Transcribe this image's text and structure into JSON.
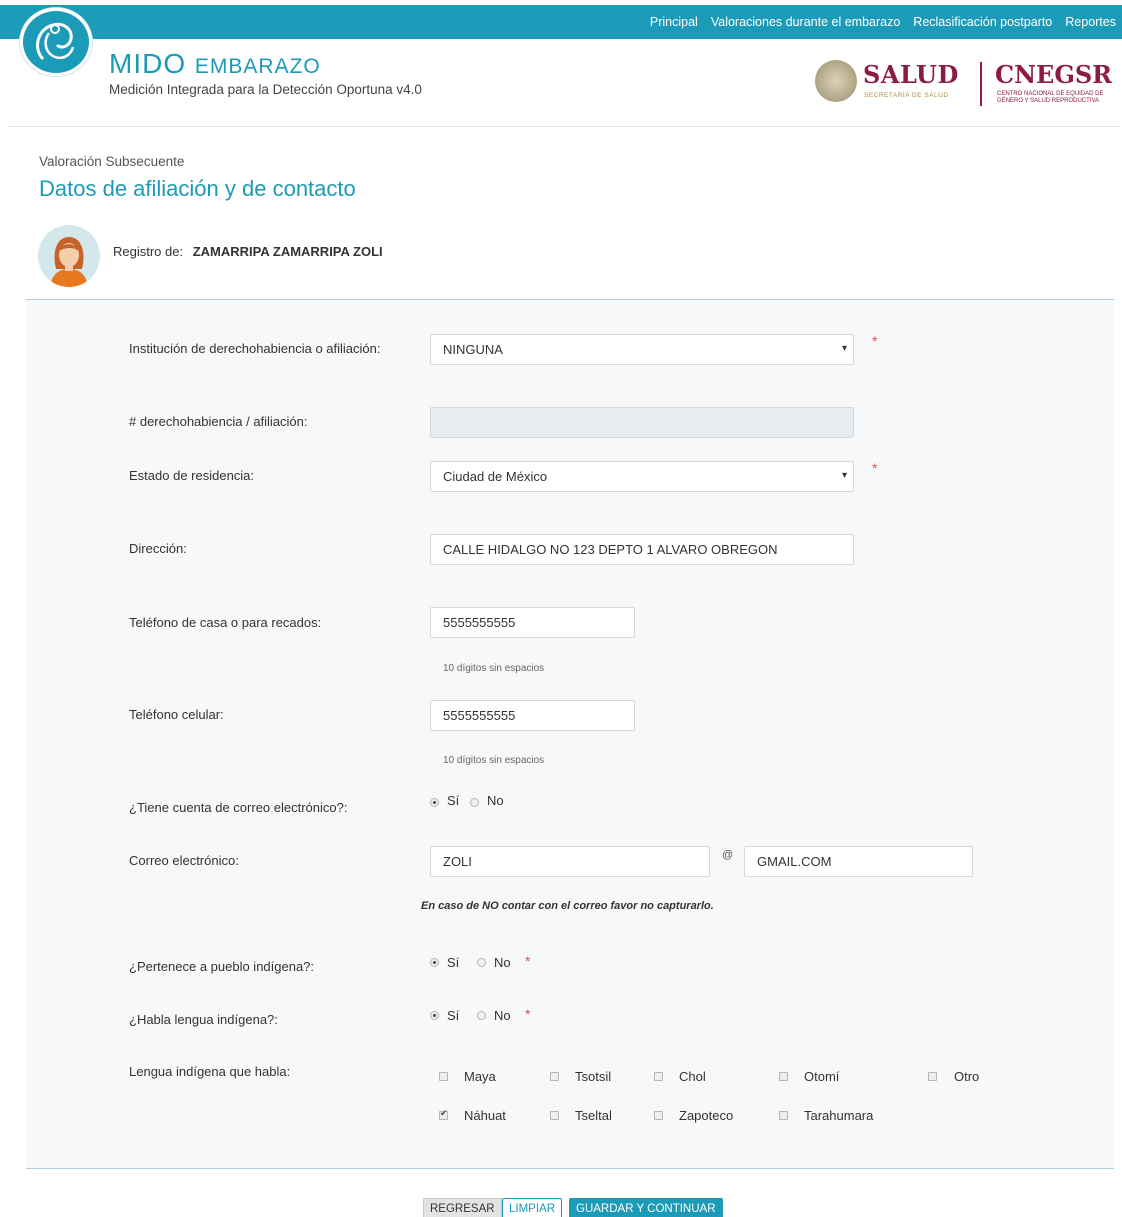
{
  "nav": {
    "items": [
      "Principal",
      "Valoraciones durante el embarazo",
      "Reclasificación postparto",
      "Reportes"
    ]
  },
  "brand": {
    "title_main": "MIDO",
    "title_rest": "EMBARAZO",
    "subtitle": "Medición Integrada para la Detección Oportuna v4.0",
    "salud": "SALUD",
    "salud_sub": "SECRETARÍA DE SALUD",
    "cnegsr": "CNEGSR",
    "cnegsr_sub": "CENTRO NACIONAL DE EQUIDAD DE GÉNERO Y SALUD REPRODUCTIVA"
  },
  "page": {
    "section": "Valoración Subsecuente",
    "title": "Datos de afiliación y de contacto",
    "registro_label": "Registro de:",
    "registro_name": "ZAMARRIPA ZAMARRIPA ZOLI"
  },
  "form": {
    "institucion_label": "Institución de derechohabiencia o afiliación:",
    "institucion_value": "NINGUNA",
    "afiliacion_label": "# derechohabiencia / afiliación:",
    "afiliacion_value": "",
    "estado_label": "Estado de residencia:",
    "estado_value": "Ciudad de México",
    "direccion_label": "Dirección:",
    "direccion_value": "CALLE HIDALGO NO 123 DEPTO 1 ALVARO OBREGON",
    "tel_casa_label": "Teléfono de casa o para recados:",
    "tel_casa_value": "5555555555",
    "tel_hint": "10 dígitos sin espacios",
    "tel_cel_label": "Teléfono celular:",
    "tel_cel_value": "5555555555",
    "correo_q_label": "¿Tiene cuenta de correo electrónico?:",
    "correo_label": "Correo electrónico:",
    "correo_user": "ZOLI",
    "at": "@",
    "correo_domain": "GMAIL.COM",
    "correo_note": "En caso de NO contar con el correo favor no capturarlo.",
    "pueblo_label": "¿Pertenece a pueblo indígena?:",
    "lengua_q_label": "¿Habla lengua indígena?:",
    "lengua_label": "Lengua indígena que habla:",
    "si": "Sí",
    "no": "No",
    "required": "*",
    "lenguas_row1": [
      "Maya",
      "Tsotsil",
      "Chol",
      "Otomí",
      "Otro"
    ],
    "lenguas_row2": [
      "Náhuat",
      "Tseltal",
      "Zapoteco",
      "Tarahumara"
    ],
    "lengua_checked": "Náhuat"
  },
  "buttons": {
    "back": "REGRESAR",
    "clear": "LIMPIAR",
    "save": "GUARDAR Y CONTINUAR"
  },
  "colors": {
    "accent": "#1b9bb8",
    "brand_red": "#8c1d3f",
    "required": "#d9534f"
  }
}
